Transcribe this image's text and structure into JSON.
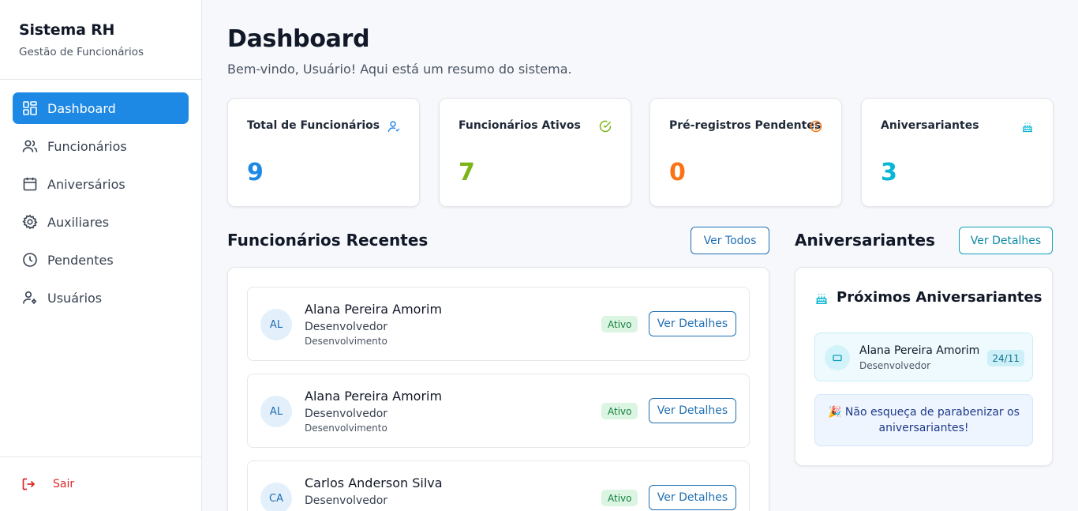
{
  "sidebar": {
    "title": "Sistema RH",
    "subtitle": "Gestão de Funcionários",
    "items": [
      {
        "label": "Dashboard",
        "icon": "dashboard-icon",
        "active": true
      },
      {
        "label": "Funcionários",
        "icon": "users-icon"
      },
      {
        "label": "Aniversários",
        "icon": "calendar-icon"
      },
      {
        "label": "Auxiliares",
        "icon": "gear-icon"
      },
      {
        "label": "Pendentes",
        "icon": "clock-icon"
      },
      {
        "label": "Usuários",
        "icon": "user-settings-icon"
      }
    ],
    "logout": "Sair"
  },
  "header": {
    "title": "Dashboard",
    "subtitle": "Bem-vindo, Usuário! Aqui está um resumo do sistema."
  },
  "stats": [
    {
      "label": "Total de Funcionários",
      "value": "9",
      "color": "#1e88e5",
      "icon": "user-icon"
    },
    {
      "label": "Funcionários Ativos",
      "value": "7",
      "color": "#7cb518",
      "icon": "check-circle-icon"
    },
    {
      "label": "Pré-registros Pendentes",
      "value": "0",
      "color": "#f97316",
      "icon": "alert-circle-icon"
    },
    {
      "label": "Aniversariantes",
      "value": "3",
      "color": "#06b6d4",
      "icon": "cake-icon"
    }
  ],
  "recent": {
    "title": "Funcionários Recentes",
    "button": "Ver Todos",
    "employees": [
      {
        "initials": "AL",
        "name": "Alana Pereira Amorim",
        "role": "Desenvolvedor",
        "dept": "Desenvolvimento",
        "status": "Ativo",
        "action": "Ver Detalhes"
      },
      {
        "initials": "AL",
        "name": "Alana Pereira Amorim",
        "role": "Desenvolvedor",
        "dept": "Desenvolvimento",
        "status": "Ativo",
        "action": "Ver Detalhes"
      },
      {
        "initials": "CA",
        "name": "Carlos Anderson Silva",
        "role": "Desenvolvedor",
        "dept": "",
        "status": "Ativo",
        "action": "Ver Detalhes"
      }
    ]
  },
  "birthdays": {
    "title": "Aniversariantes",
    "button": "Ver Detalhes",
    "panel_title": "Próximos Aniversariantes",
    "item": {
      "name": "Alana Pereira Amorim",
      "role": "Desenvolvedor",
      "date": "24/11"
    },
    "note": "🎉 Não esqueça de parabenizar os aniversariantes!"
  }
}
